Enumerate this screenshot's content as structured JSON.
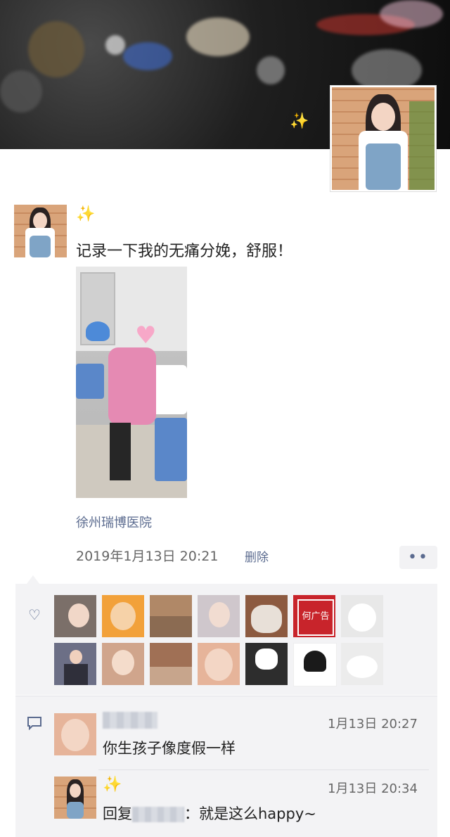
{
  "post": {
    "nickname_sparkle": "✨",
    "text": "记录一下我的无痛分娩，舒服！",
    "location": "徐州瑞博医院",
    "time": "2019年1月13日 20:21",
    "delete_label": "删除",
    "more_label": "••"
  },
  "cover": {
    "sparkle": "✨"
  },
  "likes": {
    "icon": "heart-icon",
    "avatars": [
      {
        "name": "like-avatar-1",
        "bg": "#7b6f69"
      },
      {
        "name": "like-avatar-2",
        "bg": "#f2a13a"
      },
      {
        "name": "like-avatar-3",
        "bg": "#b08867"
      },
      {
        "name": "like-avatar-4",
        "bg": "#cfc7cc"
      },
      {
        "name": "like-avatar-5",
        "bg": "#8c5a40"
      },
      {
        "name": "like-avatar-6",
        "bg": "#c8242b"
      },
      {
        "name": "like-avatar-7",
        "bg": "#e8e8e8"
      },
      {
        "name": "like-avatar-8",
        "bg": "#6c6f86"
      },
      {
        "name": "like-avatar-9",
        "bg": "#d0a58c"
      },
      {
        "name": "like-avatar-10",
        "bg": "#a07055"
      },
      {
        "name": "like-avatar-11",
        "bg": "#e6b49a"
      },
      {
        "name": "like-avatar-12",
        "bg": "#2d2d2d"
      },
      {
        "name": "like-avatar-13",
        "bg": "#ffffff"
      },
      {
        "name": "like-avatar-14",
        "bg": "#ececec"
      }
    ],
    "avatar6_text": "何广告"
  },
  "comments": [
    {
      "time": "1月13日 20:27",
      "text": "你生孩子像度假一样"
    },
    {
      "name_sparkle": "✨",
      "time": "1月13日 20:34",
      "reply_prefix": "回复",
      "reply_suffix": "：就是这么happy~"
    }
  ],
  "colors": {
    "link": "#5b6b8f",
    "sparkle": "#f5b400",
    "panel": "#f3f3f5"
  }
}
